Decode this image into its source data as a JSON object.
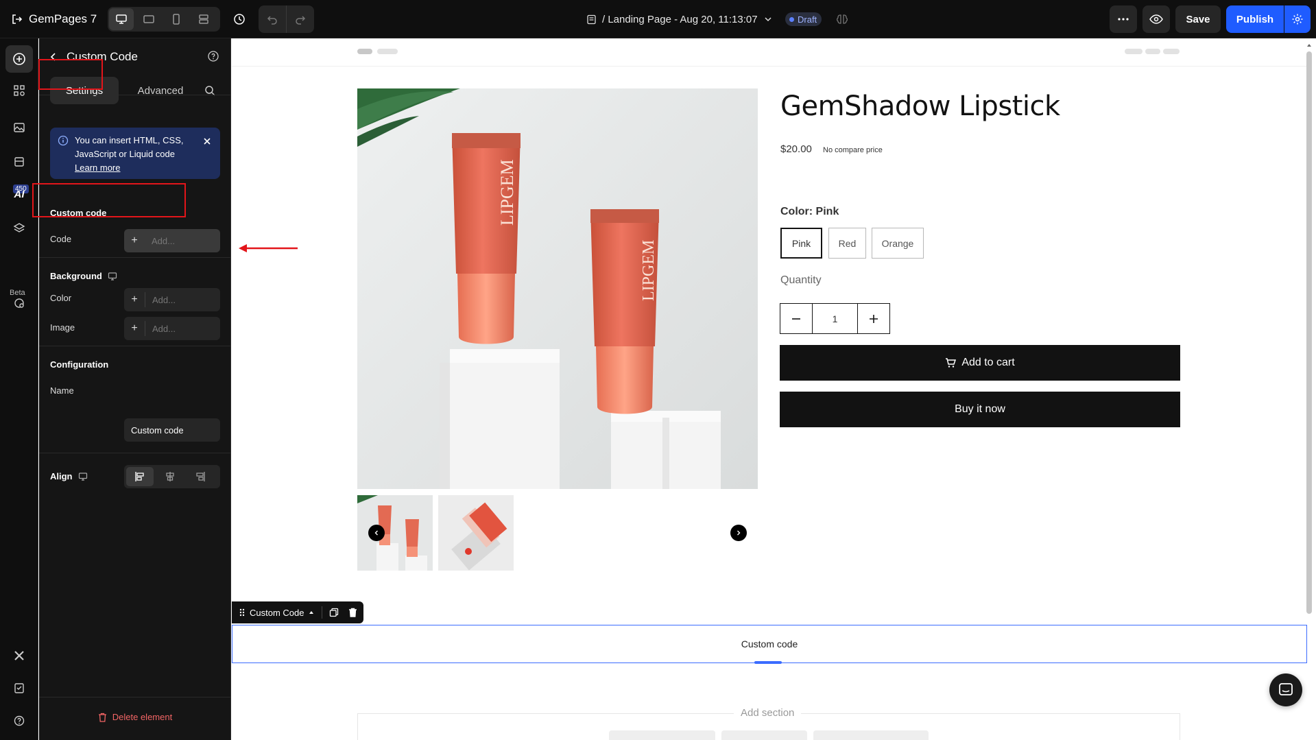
{
  "topbar": {
    "app_name": "GemPages 7",
    "page_title": "/ Landing Page - Aug 20, 11:13:07",
    "status_badge": "Draft",
    "save_label": "Save",
    "publish_label": "Publish",
    "active_device": "desktop"
  },
  "rail": {
    "badge_count": "450",
    "beta_label": "Beta",
    "ai_label": "AI"
  },
  "panel": {
    "title": "Custom Code",
    "tabs": [
      {
        "label": "Settings",
        "active": true
      },
      {
        "label": "Advanced",
        "active": false
      }
    ],
    "info": {
      "text": "You can insert HTML, CSS, JavaScript or Liquid code",
      "link": "Learn more"
    },
    "custom_code": {
      "section_label": "Custom code",
      "code_label": "Code",
      "code_placeholder": "Add..."
    },
    "background": {
      "section_label": "Background",
      "color_label": "Color",
      "color_placeholder": "Add...",
      "image_label": "Image",
      "image_placeholder": "Add..."
    },
    "configuration": {
      "section_label": "Configuration",
      "name_label": "Name",
      "name_value": "Custom code"
    },
    "align": {
      "label": "Align",
      "selected": "left"
    },
    "delete_label": "Delete element"
  },
  "product": {
    "title": "GemShadow Lipstick",
    "price": "$20.00",
    "compare_price": "No compare price",
    "color_label": "Color: Pink",
    "colors": [
      "Pink",
      "Red",
      "Orange"
    ],
    "selected_color": "Pink",
    "quantity_label": "Quantity",
    "quantity": "1",
    "add_to_cart": "Add to cart",
    "buy_now": "Buy it now",
    "image_brand_text": "LIPGEM"
  },
  "canvas": {
    "element_toolbar_label": "Custom Code",
    "custom_code_block_text": "Custom code",
    "add_section_label": "Add section"
  },
  "colors": {
    "accent": "#1f5cff",
    "highlight": "#e3151a",
    "panel_bg": "#151515",
    "selection": "#3b6cff"
  }
}
